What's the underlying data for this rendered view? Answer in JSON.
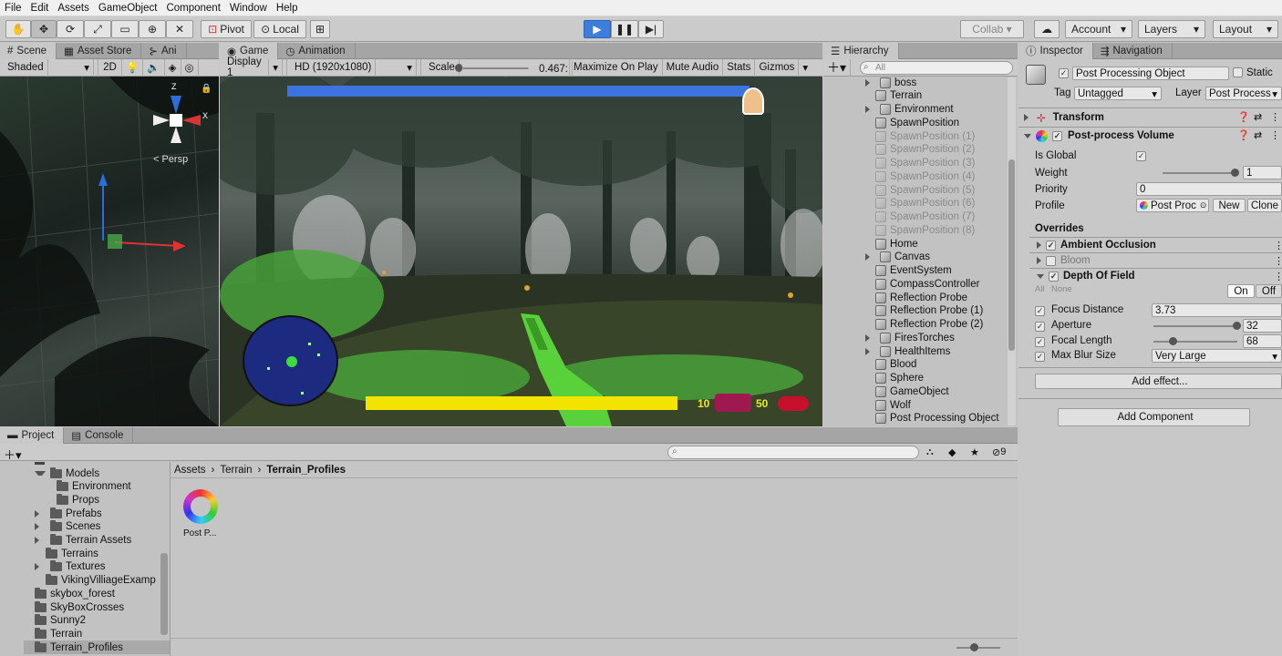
{
  "menu": [
    "File",
    "Edit",
    "Assets",
    "GameObject",
    "Component",
    "Window",
    "Help"
  ],
  "toolbar": {
    "pivot": "Pivot",
    "local": "Local",
    "collab": "Collab",
    "account": "Account",
    "layers": "Layers",
    "layout": "Layout"
  },
  "scene": {
    "tabs": [
      "Scene",
      "Asset Store",
      "Ani"
    ],
    "shading": "Shaded",
    "mode2d": "2D",
    "persp": "< Persp"
  },
  "game": {
    "tabs": [
      "Game",
      "Animation"
    ],
    "display": "Display 1",
    "resolution": "HD (1920x1080)",
    "scale_label": "Scale",
    "scale_value": "0.467:",
    "maximize": "Maximize On Play",
    "mute": "Mute Audio",
    "stats": "Stats",
    "gizmos": "Gizmos",
    "hud_left": "10",
    "hud_right": "50",
    "top_bar_fill": 0.99,
    "bottom_bar_fill": 1.0
  },
  "hierarchy": {
    "tab": "Hierarchy",
    "search_placeholder": "All",
    "items": [
      {
        "label": "boss",
        "dim": false,
        "arrow": true
      },
      {
        "label": "Terrain",
        "dim": false,
        "arrow": false
      },
      {
        "label": "Environment",
        "dim": false,
        "arrow": true
      },
      {
        "label": "SpawnPosition",
        "dim": false,
        "arrow": false
      },
      {
        "label": "SpawnPosition (1)",
        "dim": true,
        "arrow": false
      },
      {
        "label": "SpawnPosition (2)",
        "dim": true,
        "arrow": false
      },
      {
        "label": "SpawnPosition (3)",
        "dim": true,
        "arrow": false
      },
      {
        "label": "SpawnPosition (4)",
        "dim": true,
        "arrow": false
      },
      {
        "label": "SpawnPosition (5)",
        "dim": true,
        "arrow": false
      },
      {
        "label": "SpawnPosition (6)",
        "dim": true,
        "arrow": false
      },
      {
        "label": "SpawnPosition (7)",
        "dim": true,
        "arrow": false
      },
      {
        "label": "SpawnPosition (8)",
        "dim": true,
        "arrow": false
      },
      {
        "label": "Home",
        "dim": false,
        "arrow": false
      },
      {
        "label": "Canvas",
        "dim": false,
        "arrow": true
      },
      {
        "label": "EventSystem",
        "dim": false,
        "arrow": false
      },
      {
        "label": "CompassController",
        "dim": false,
        "arrow": false
      },
      {
        "label": "Reflection Probe",
        "dim": false,
        "arrow": false
      },
      {
        "label": "Reflection Probe (1)",
        "dim": false,
        "arrow": false
      },
      {
        "label": "Reflection Probe (2)",
        "dim": false,
        "arrow": false
      },
      {
        "label": "FiresTorches",
        "dim": false,
        "arrow": true
      },
      {
        "label": "HealthItems",
        "dim": false,
        "arrow": true
      },
      {
        "label": "Blood",
        "dim": false,
        "arrow": false
      },
      {
        "label": "Sphere",
        "dim": false,
        "arrow": false
      },
      {
        "label": "GameObject",
        "dim": false,
        "arrow": false
      },
      {
        "label": "Wolf",
        "dim": false,
        "arrow": false
      },
      {
        "label": "Post Processing Object",
        "dim": false,
        "arrow": false
      }
    ]
  },
  "inspector": {
    "tabs": [
      "Inspector",
      "Navigation"
    ],
    "object_name": "Post Processing Object",
    "static": "Static",
    "tag_label": "Tag",
    "tag_value": "Untagged",
    "layer_label": "Layer",
    "layer_value": "Post Process",
    "transform": "Transform",
    "ppv": "Post-process Volume",
    "is_global": "Is Global",
    "weight": "Weight",
    "weight_value": "1",
    "weight_fill": 1.0,
    "priority": "Priority",
    "priority_value": "0",
    "profile": "Profile",
    "profile_value": "Post Proc",
    "new": "New",
    "clone": "Clone",
    "overrides": "Overrides",
    "ao": "Ambient Occlusion",
    "bloom": "Bloom",
    "dof": "Depth Of Field",
    "all": "All",
    "none": "None",
    "on": "On",
    "off": "Off",
    "focus_distance": "Focus Distance",
    "focus_value": "3.73",
    "aperture": "Aperture",
    "aperture_value": "32",
    "aperture_fill": 1.0,
    "focal_length": "Focal Length",
    "focal_value": "68",
    "focal_fill": 0.24,
    "max_blur": "Max Blur Size",
    "max_blur_value": "Very Large",
    "add_effect": "Add effect...",
    "add_component": "Add Component"
  },
  "project": {
    "tabs": [
      "Project",
      "Console"
    ],
    "breadcrumb": [
      "Assets",
      "Terrain",
      "Terrain_Profiles"
    ],
    "count": "9",
    "asset_label": "Post P...",
    "tree": [
      {
        "label": "Models",
        "indent": 1,
        "arrow": "down"
      },
      {
        "label": "Environment",
        "indent": 2,
        "arrow": ""
      },
      {
        "label": "Props",
        "indent": 2,
        "arrow": ""
      },
      {
        "label": "Prefabs",
        "indent": 1,
        "arrow": "right"
      },
      {
        "label": "Scenes",
        "indent": 1,
        "arrow": "right"
      },
      {
        "label": "Terrain Assets",
        "indent": 1,
        "arrow": "right"
      },
      {
        "label": "Terrains",
        "indent": 1,
        "arrow": ""
      },
      {
        "label": "Textures",
        "indent": 1,
        "arrow": "right"
      },
      {
        "label": "VikingVilliageExamp",
        "indent": 1,
        "arrow": ""
      },
      {
        "label": "skybox_forest",
        "indent": 0,
        "arrow": ""
      },
      {
        "label": "SkyBoxCrosses",
        "indent": 0,
        "arrow": ""
      },
      {
        "label": "Sunny2",
        "indent": 0,
        "arrow": ""
      },
      {
        "label": "Terrain",
        "indent": 0,
        "arrow": ""
      },
      {
        "label": "Terrain_Profiles",
        "indent": 0,
        "arrow": ""
      }
    ]
  }
}
